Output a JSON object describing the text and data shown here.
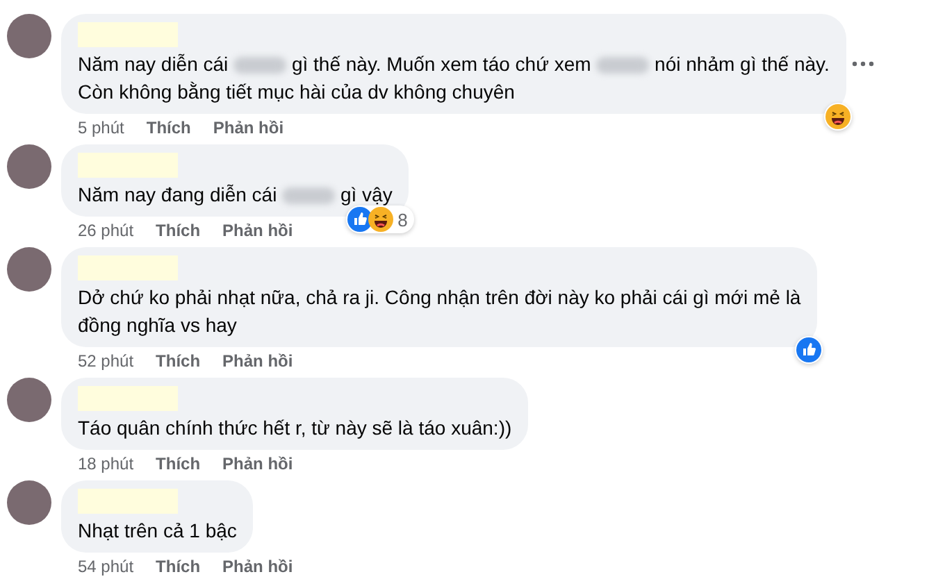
{
  "comments": [
    {
      "segments": [
        {
          "kind": "text",
          "text": "Năm nay diễn cái "
        },
        {
          "kind": "blurred"
        },
        {
          "kind": "text",
          "text": " gì thế này. Muốn xem táo chứ xem "
        },
        {
          "kind": "blurred"
        },
        {
          "kind": "text",
          "text": " nói nhảm gì thế này."
        },
        {
          "kind": "break"
        },
        {
          "kind": "text",
          "text": "Còn không bằng tiết mục hài của dv không chuyên"
        }
      ],
      "time": "5 phút",
      "like": "Thích",
      "reply": "Phản hồi",
      "haha_reaction": true,
      "more": true
    },
    {
      "segments": [
        {
          "kind": "text",
          "text": "Năm nay đang diễn cái "
        },
        {
          "kind": "blurred"
        },
        {
          "kind": "text",
          "text": " gì vậy"
        }
      ],
      "time": "26 phút",
      "like": "Thích",
      "reply": "Phản hồi",
      "like_reaction": true,
      "haha_reaction": true,
      "reaction_count": "8"
    },
    {
      "segments": [
        {
          "kind": "text",
          "text": "Dở chứ ko phải nhạt nữa, chả ra ji. Công nhận trên đời này ko phải cái gì mới mẻ là"
        },
        {
          "kind": "break"
        },
        {
          "kind": "text",
          "text": "đồng nghĩa vs hay"
        }
      ],
      "time": "52 phút",
      "like": "Thích",
      "reply": "Phản hồi",
      "like_reaction": true
    },
    {
      "segments": [
        {
          "kind": "text",
          "text": "Táo quân chính thức hết r, từ này sẽ là táo xuân:))"
        }
      ],
      "time": "18 phút",
      "like": "Thích",
      "reply": "Phản hồi"
    },
    {
      "segments": [
        {
          "kind": "text",
          "text": "Nhạt trên cả 1 bậc"
        }
      ],
      "time": "54 phút",
      "like": "Thích",
      "reply": "Phản hồi"
    }
  ]
}
